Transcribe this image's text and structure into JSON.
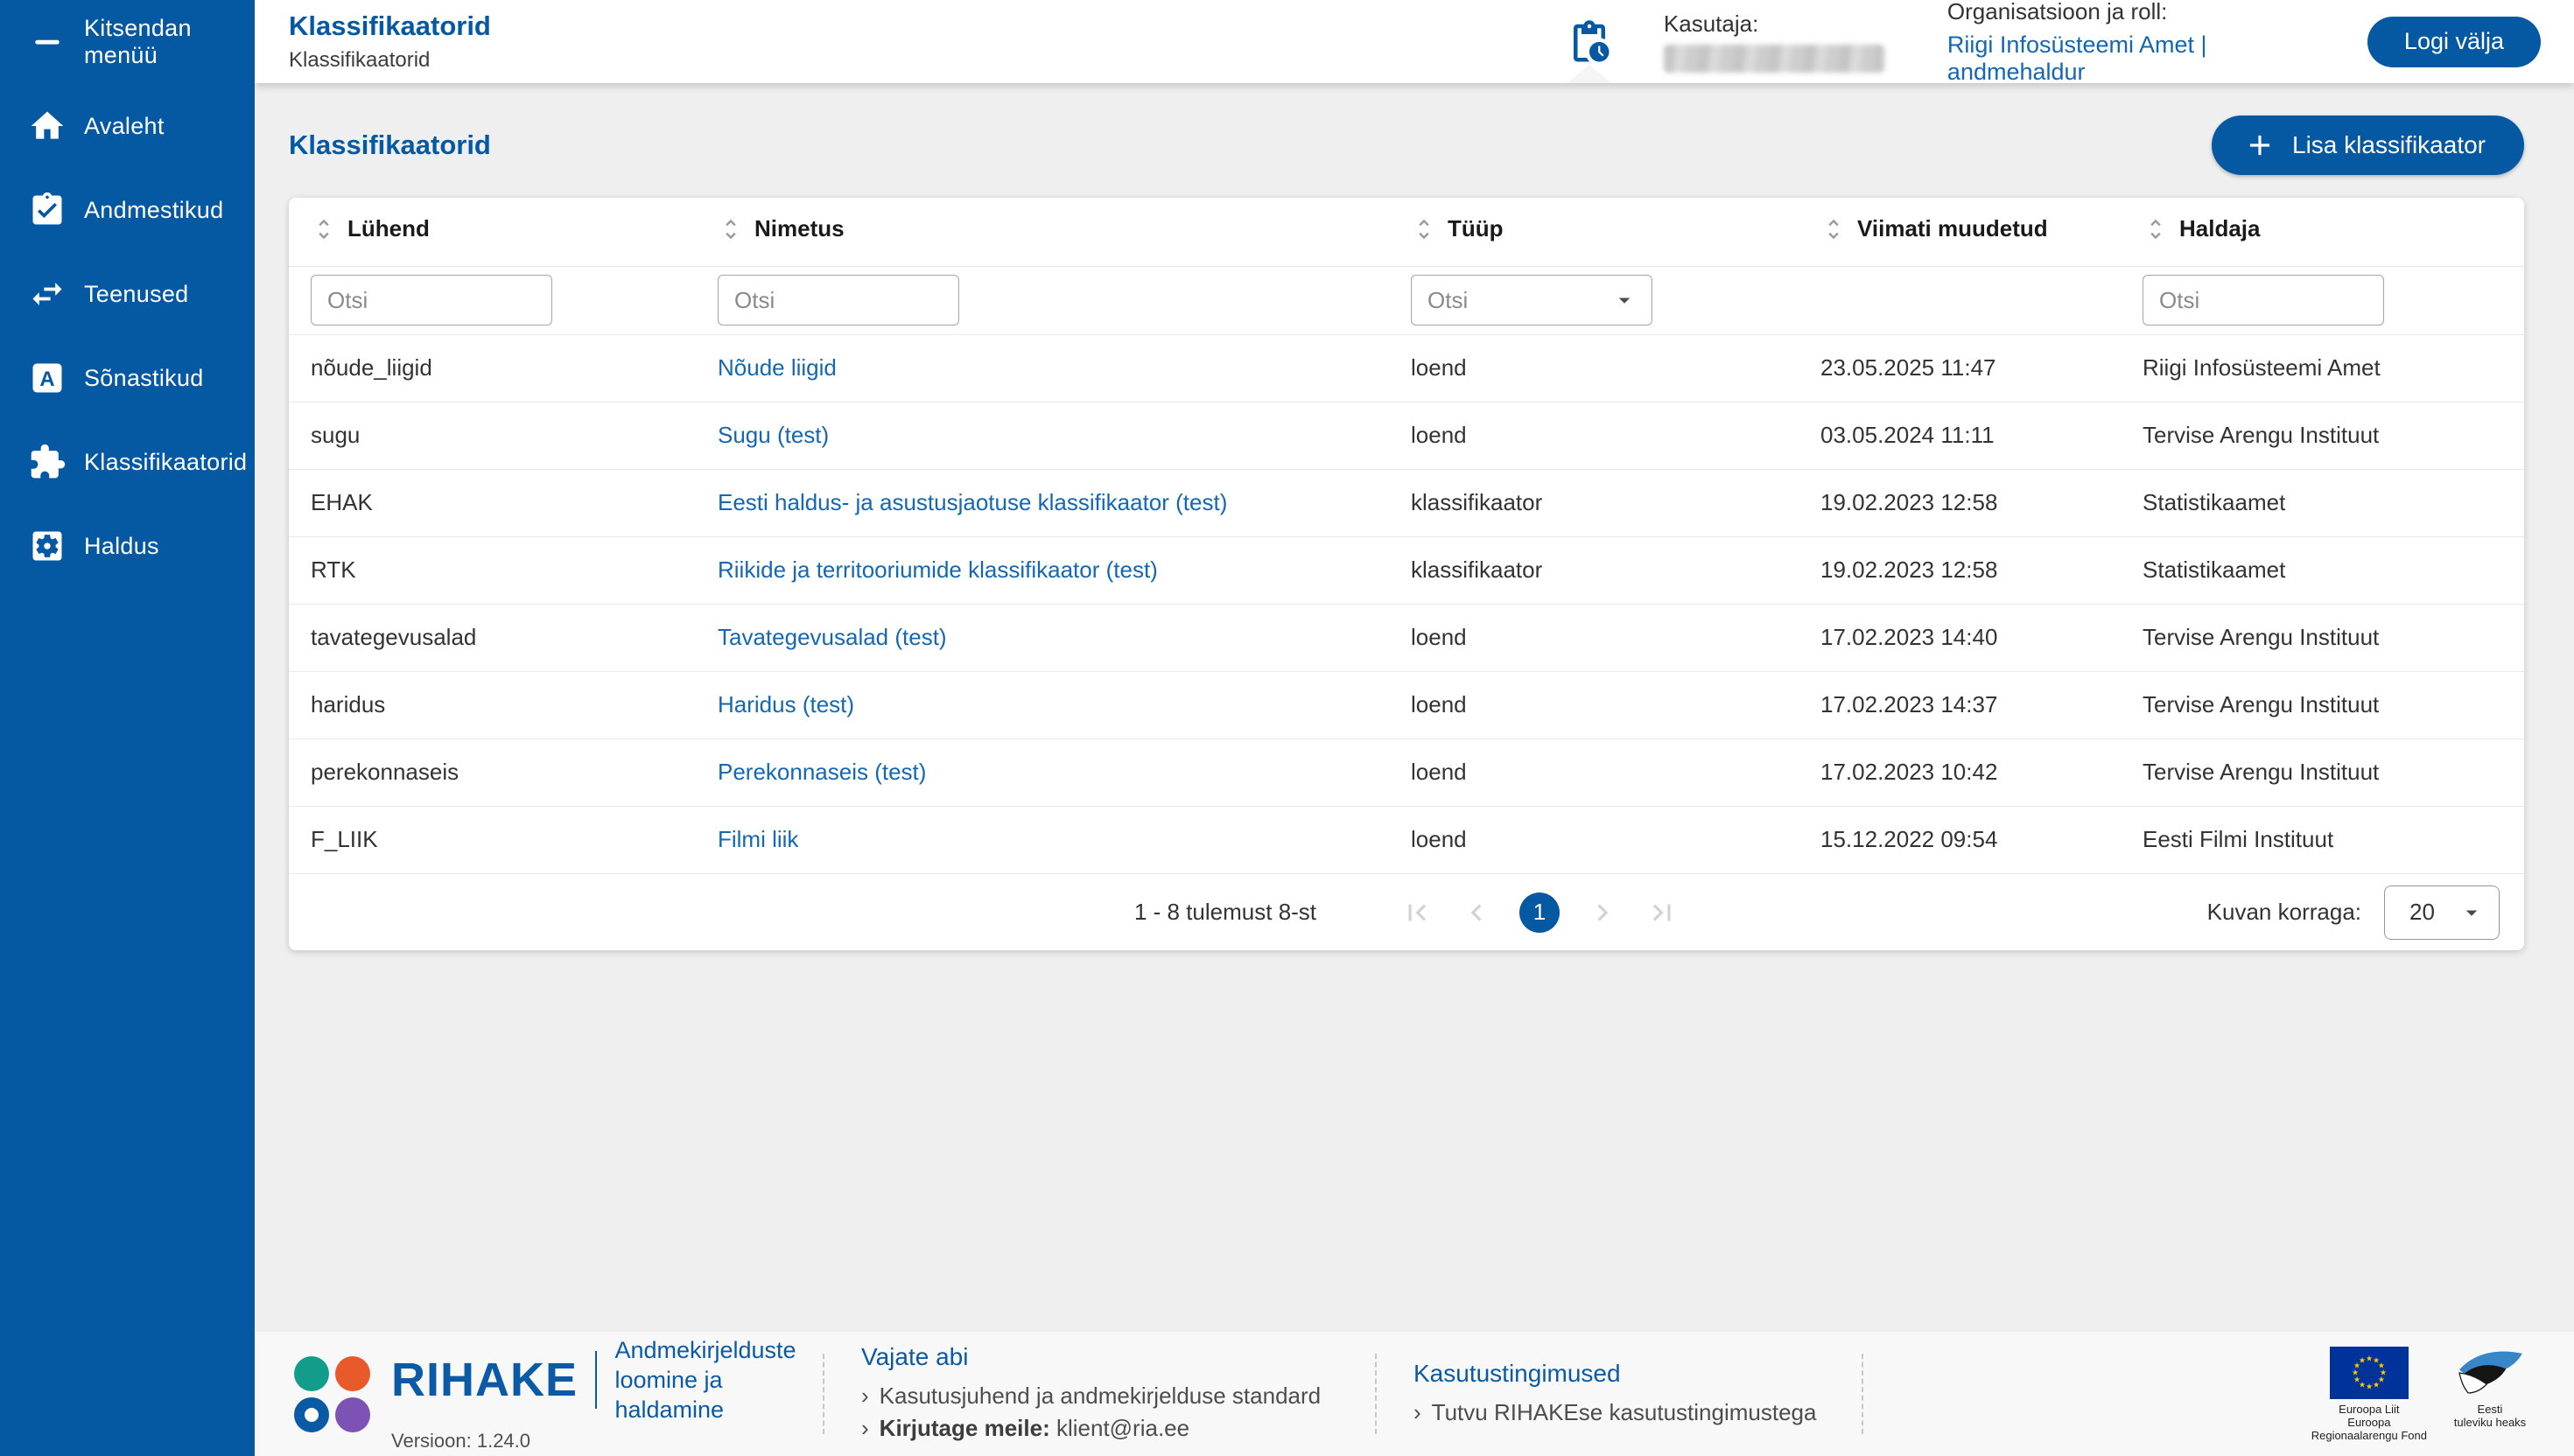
{
  "colors": {
    "primary_blue": "#0558A2",
    "link_blue": "#1467B2",
    "body_bg": "#EFEFF0",
    "footer_bg": "#F8F8F8",
    "logo_teal": "#149C8A",
    "logo_orange": "#E95A2B",
    "logo_purple": "#7C52B5",
    "eu_flag_blue": "#003399",
    "eu_star_yellow": "#FFCC00"
  },
  "sidebar": {
    "items": [
      {
        "label": "Kitsendan menüü",
        "icon": "collapse-menu-icon"
      },
      {
        "label": "Avaleht",
        "icon": "home-icon"
      },
      {
        "label": "Andmestikud",
        "icon": "clipboard-check-icon"
      },
      {
        "label": "Teenused",
        "icon": "swap-arrows-icon"
      },
      {
        "label": "Sõnastikud",
        "icon": "dictionary-icon"
      },
      {
        "label": "Klassifikaatorid",
        "icon": "puzzle-icon"
      },
      {
        "label": "Haldus",
        "icon": "gear-square-icon"
      }
    ]
  },
  "header": {
    "title": "Klassifikaatorid",
    "breadcrumb": "Klassifikaatorid",
    "user_label": "Kasutaja:",
    "org_label": "Organisatsioon ja roll:",
    "org_value": "Riigi Infosüsteemi Amet | andmehaldur",
    "logout_label": "Logi välja"
  },
  "page": {
    "title": "Klassifikaatorid",
    "add_button_label": "Lisa klassifikaator"
  },
  "table": {
    "columns": [
      "Lühend",
      "Nimetus",
      "Tüüp",
      "Viimati muudetud",
      "Haldaja"
    ],
    "filter_placeholder": "Otsi",
    "rows": [
      {
        "luhend": "nõude_liigid",
        "nimetus": "Nõude liigid",
        "tyyp": "loend",
        "muudetud": "23.05.2025 11:47",
        "haldaja": "Riigi Infosüsteemi Amet"
      },
      {
        "luhend": "sugu",
        "nimetus": "Sugu (test)",
        "tyyp": "loend",
        "muudetud": "03.05.2024 11:11",
        "haldaja": "Tervise Arengu Instituut"
      },
      {
        "luhend": "EHAK",
        "nimetus": "Eesti haldus- ja asustusjaotuse klassifikaator (test)",
        "tyyp": "klassifikaator",
        "muudetud": "19.02.2023 12:58",
        "haldaja": "Statistikaamet"
      },
      {
        "luhend": "RTK",
        "nimetus": "Riikide ja territooriumide klassifikaator (test)",
        "tyyp": "klassifikaator",
        "muudetud": "19.02.2023 12:58",
        "haldaja": "Statistikaamet"
      },
      {
        "luhend": "tavategevusalad",
        "nimetus": "Tavategevusalad (test)",
        "tyyp": "loend",
        "muudetud": "17.02.2023 14:40",
        "haldaja": "Tervise Arengu Instituut"
      },
      {
        "luhend": "haridus",
        "nimetus": "Haridus (test)",
        "tyyp": "loend",
        "muudetud": "17.02.2023 14:37",
        "haldaja": "Tervise Arengu Instituut"
      },
      {
        "luhend": "perekonnaseis",
        "nimetus": "Perekonnaseis (test)",
        "tyyp": "loend",
        "muudetud": "17.02.2023 10:42",
        "haldaja": "Tervise Arengu Instituut"
      },
      {
        "luhend": "F_LIIK",
        "nimetus": "Filmi liik",
        "tyyp": "loend",
        "muudetud": "15.12.2022 09:54",
        "haldaja": "Eesti Filmi Instituut"
      }
    ]
  },
  "pagination": {
    "summary": "1 - 8 tulemust 8-st",
    "current_page": "1",
    "page_size_label": "Kuvan korraga:",
    "page_size": "20"
  },
  "footer": {
    "brand": "RIHAKE",
    "tagline_line1": "Andmekirjelduste",
    "tagline_line2": "loomine ja haldamine",
    "version": "Versioon: 1.24.0",
    "help": {
      "heading": "Vajate abi",
      "links": [
        {
          "prefix": "",
          "text": "Kasutusjuhend ja andmekirjelduse standard"
        },
        {
          "prefix": "Kirjutage meile:",
          "text": "klient@ria.ee"
        }
      ]
    },
    "terms": {
      "heading": "Kasutustingimused",
      "links": [
        {
          "prefix": "",
          "text": "Tutvu RIHAKEse kasutustingimustega"
        }
      ]
    },
    "eu_logo_caption": [
      "Euroopa Liit",
      "Euroopa",
      "Regionaalarengu Fond"
    ],
    "estonia_logo_caption": [
      "Eesti",
      "tuleviku heaks"
    ]
  }
}
